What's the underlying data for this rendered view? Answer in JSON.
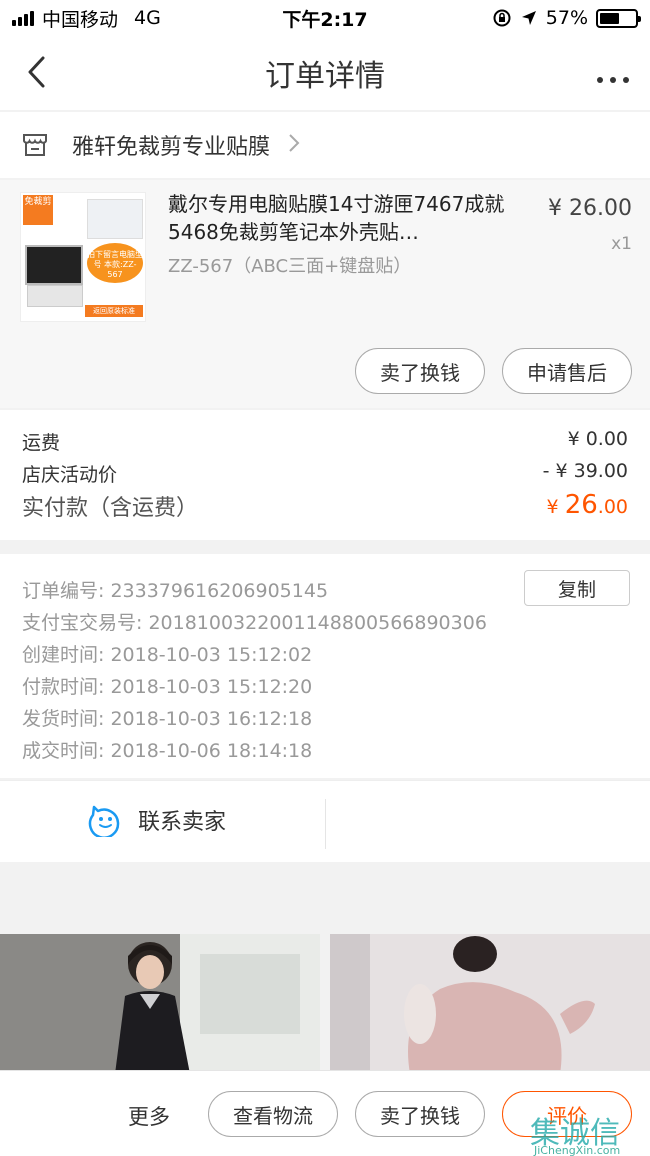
{
  "status_bar": {
    "carrier": "中国移动",
    "network": "4G",
    "time": "下午2:17",
    "battery": "57%",
    "battery_level": 0.57
  },
  "nav": {
    "title": "订单详情",
    "more_icon": "more-dots-icon",
    "back_icon": "chevron-left-icon"
  },
  "shop": {
    "name": "雅轩免裁剪专业贴膜"
  },
  "product": {
    "title": "戴尔专用电脑贴膜14寸游匣7467成就5468免裁剪笔记本外壳贴…",
    "sku": "ZZ-567（ABC三面+键盘贴）",
    "price": "¥ 26.00",
    "qty": "x1",
    "thumb_badge": "免裁剪",
    "thumb_tag": "拍下留言电脑型号 本款:ZZ-567",
    "thumb_strip": "返回原装标准",
    "btn_sell": "卖了换钱",
    "btn_after_sale": "申请售后"
  },
  "fees": {
    "shipping_label": "运费",
    "shipping_value": "¥ 0.00",
    "promo_label": "店庆活动价",
    "promo_value": "- ¥ 39.00",
    "paid_label": "实付款（含运费）",
    "paid_currency": "¥ ",
    "paid_int": "26",
    "paid_dec": ".00"
  },
  "info": {
    "order_no": "订单编号:   233379616206905145",
    "alipay_no": "支付宝交易号:   2018100322001148800566890306",
    "created": "创建时间:   2018-10-03 15:12:02",
    "paid": "付款时间:   2018-10-03 15:12:20",
    "shipped": "发货时间:   2018-10-03 16:12:18",
    "completed": "成交时间:   2018-10-06 18:14:18",
    "copy_label": "复制"
  },
  "contact": {
    "label": "联系卖家"
  },
  "bottom": {
    "more": "更多",
    "logistics": "查看物流",
    "sell": "卖了换钱",
    "review": "评价"
  },
  "watermark": {
    "text": "集诚信",
    "url": "JiChengXin.com"
  },
  "colors": {
    "accent": "#ff5500",
    "contact_icon": "#1a9af2"
  }
}
